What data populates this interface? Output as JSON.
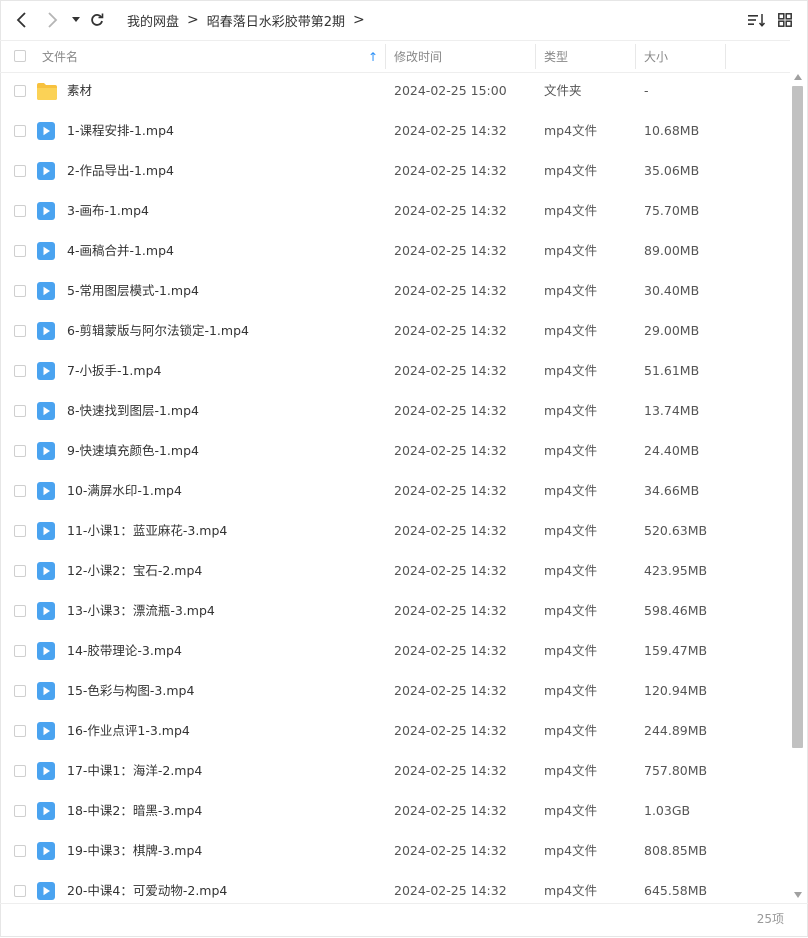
{
  "toolbar": {
    "back_icon": "chevron-left-icon",
    "forward_icon": "chevron-right-icon",
    "history_icon": "caret-down-icon",
    "refresh_icon": "refresh-icon",
    "sort_icon": "sort-icon",
    "view_icon": "grid-view-icon"
  },
  "breadcrumb": {
    "items": [
      "我的网盘",
      "昭春落日水彩胶带第2期"
    ],
    "separator": ">"
  },
  "columns": {
    "name": "文件名",
    "modified": "修改时间",
    "type": "类型",
    "size": "大小",
    "sort_arrow": "↑"
  },
  "files": [
    {
      "name": "素材",
      "time": "2024-02-25 15:00",
      "type": "文件夹",
      "size": "-",
      "kind": "folder"
    },
    {
      "name": "1-课程安排-1.mp4",
      "time": "2024-02-25 14:32",
      "type": "mp4文件",
      "size": "10.68MB",
      "kind": "video"
    },
    {
      "name": "2-作品导出-1.mp4",
      "time": "2024-02-25 14:32",
      "type": "mp4文件",
      "size": "35.06MB",
      "kind": "video"
    },
    {
      "name": "3-画布-1.mp4",
      "time": "2024-02-25 14:32",
      "type": "mp4文件",
      "size": "75.70MB",
      "kind": "video"
    },
    {
      "name": "4-画稿合并-1.mp4",
      "time": "2024-02-25 14:32",
      "type": "mp4文件",
      "size": "89.00MB",
      "kind": "video"
    },
    {
      "name": "5-常用图层模式-1.mp4",
      "time": "2024-02-25 14:32",
      "type": "mp4文件",
      "size": "30.40MB",
      "kind": "video"
    },
    {
      "name": "6-剪辑蒙版与阿尔法锁定-1.mp4",
      "time": "2024-02-25 14:32",
      "type": "mp4文件",
      "size": "29.00MB",
      "kind": "video"
    },
    {
      "name": "7-小扳手-1.mp4",
      "time": "2024-02-25 14:32",
      "type": "mp4文件",
      "size": "51.61MB",
      "kind": "video"
    },
    {
      "name": "8-快速找到图层-1.mp4",
      "time": "2024-02-25 14:32",
      "type": "mp4文件",
      "size": "13.74MB",
      "kind": "video"
    },
    {
      "name": "9-快速填充颜色-1.mp4",
      "time": "2024-02-25 14:32",
      "type": "mp4文件",
      "size": "24.40MB",
      "kind": "video"
    },
    {
      "name": "10-满屏水印-1.mp4",
      "time": "2024-02-25 14:32",
      "type": "mp4文件",
      "size": "34.66MB",
      "kind": "video"
    },
    {
      "name": "11-小课1：蓝亚麻花-3.mp4",
      "time": "2024-02-25 14:32",
      "type": "mp4文件",
      "size": "520.63MB",
      "kind": "video"
    },
    {
      "name": "12-小课2：宝石-2.mp4",
      "time": "2024-02-25 14:32",
      "type": "mp4文件",
      "size": "423.95MB",
      "kind": "video"
    },
    {
      "name": "13-小课3：漂流瓶-3.mp4",
      "time": "2024-02-25 14:32",
      "type": "mp4文件",
      "size": "598.46MB",
      "kind": "video"
    },
    {
      "name": "14-胶带理论-3.mp4",
      "time": "2024-02-25 14:32",
      "type": "mp4文件",
      "size": "159.47MB",
      "kind": "video"
    },
    {
      "name": "15-色彩与构图-3.mp4",
      "time": "2024-02-25 14:32",
      "type": "mp4文件",
      "size": "120.94MB",
      "kind": "video"
    },
    {
      "name": "16-作业点评1-3.mp4",
      "time": "2024-02-25 14:32",
      "type": "mp4文件",
      "size": "244.89MB",
      "kind": "video"
    },
    {
      "name": "17-中课1：海洋-2.mp4",
      "time": "2024-02-25 14:32",
      "type": "mp4文件",
      "size": "757.80MB",
      "kind": "video"
    },
    {
      "name": "18-中课2：暗黑-3.mp4",
      "time": "2024-02-25 14:32",
      "type": "mp4文件",
      "size": "1.03GB",
      "kind": "video"
    },
    {
      "name": "19-中课3：棋牌-3.mp4",
      "time": "2024-02-25 14:32",
      "type": "mp4文件",
      "size": "808.85MB",
      "kind": "video"
    },
    {
      "name": "20-中课4：可爱动物-2.mp4",
      "time": "2024-02-25 14:32",
      "type": "mp4文件",
      "size": "645.58MB",
      "kind": "video"
    }
  ],
  "footer": {
    "count": "25项"
  },
  "colors": {
    "accent": "#2a8ff7",
    "folder": "#f7c13e",
    "video": "#4aa3f0"
  }
}
